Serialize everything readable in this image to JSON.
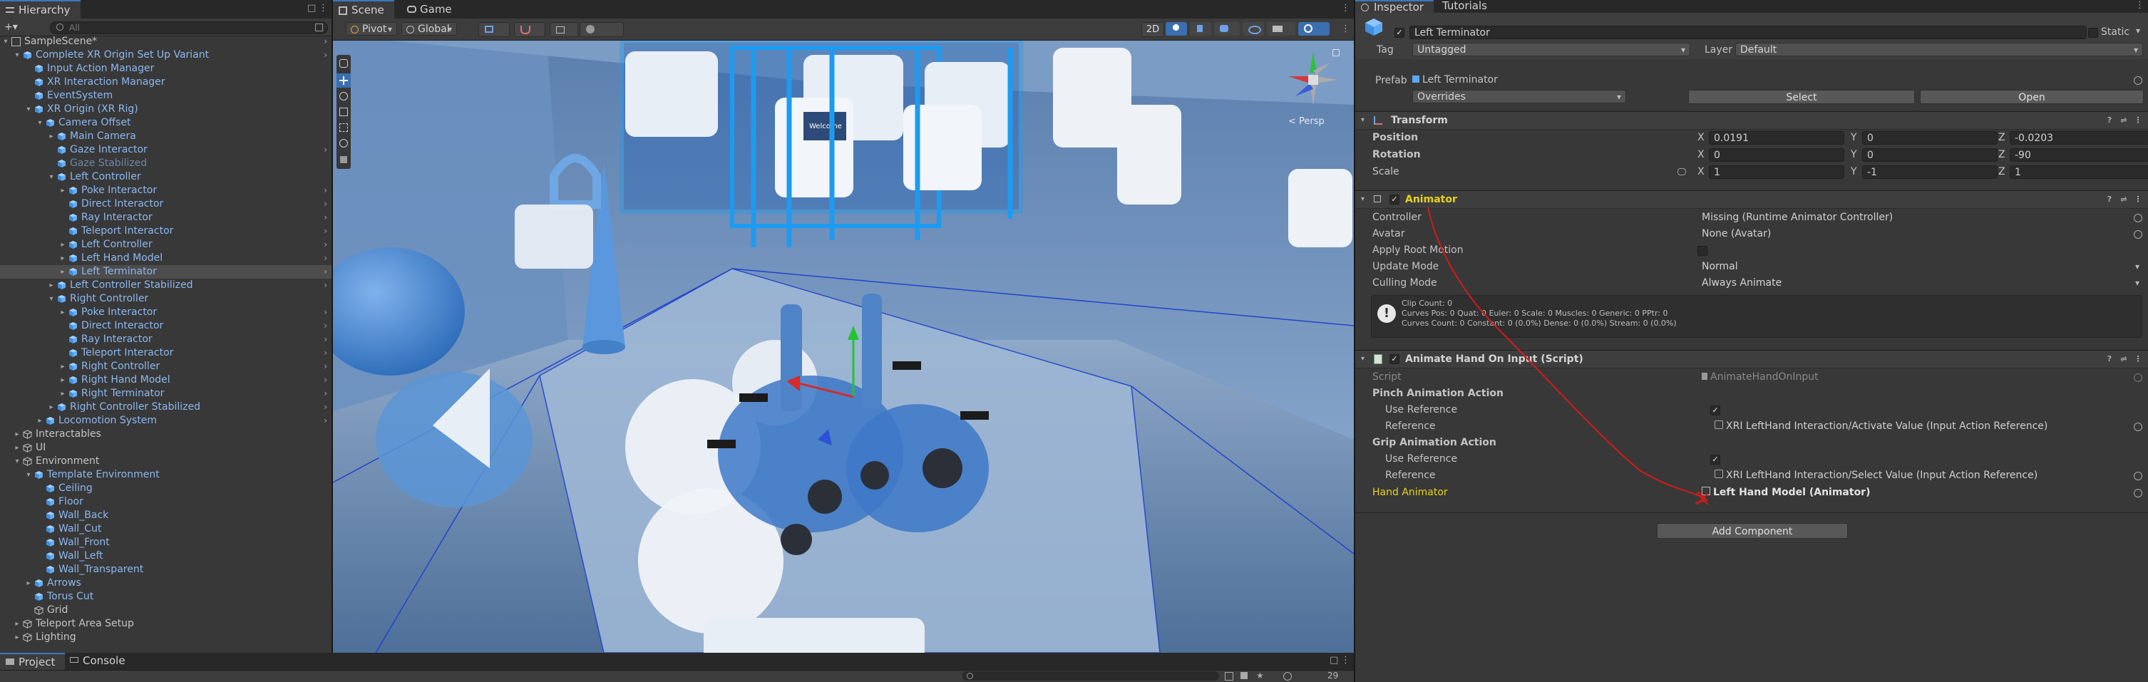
{
  "hierarchy": {
    "tab": "Hierarchy",
    "search_placeholder": "All",
    "rows": [
      {
        "label": "SampleScene*",
        "level": 0,
        "arrow": "▾",
        "kind": "scene",
        "sel": false,
        "more": true
      },
      {
        "label": "Complete XR Origin Set Up Variant",
        "level": 1,
        "arrow": "▾",
        "kind": "prefab",
        "sel": false,
        "more": true
      },
      {
        "label": "Input Action Manager",
        "level": 2,
        "arrow": "",
        "kind": "prefab",
        "sel": false,
        "more": false
      },
      {
        "label": "XR Interaction Manager",
        "level": 2,
        "arrow": "",
        "kind": "prefab",
        "sel": false,
        "more": false
      },
      {
        "label": "EventSystem",
        "level": 2,
        "arrow": "",
        "kind": "prefab",
        "sel": false,
        "more": false
      },
      {
        "label": "XR Origin (XR Rig)",
        "level": 2,
        "arrow": "▾",
        "kind": "prefab",
        "sel": false,
        "more": false
      },
      {
        "label": "Camera Offset",
        "level": 3,
        "arrow": "▾",
        "kind": "prefab",
        "sel": false,
        "more": false
      },
      {
        "label": "Main Camera",
        "level": 4,
        "arrow": "▸",
        "kind": "prefab",
        "sel": false,
        "more": false
      },
      {
        "label": "Gaze Interactor",
        "level": 4,
        "arrow": "",
        "kind": "prefab",
        "sel": false,
        "more": true
      },
      {
        "label": "Gaze Stabilized",
        "level": 4,
        "arrow": "",
        "kind": "dim",
        "sel": false,
        "more": false
      },
      {
        "label": "Left Controller",
        "level": 4,
        "arrow": "▾",
        "kind": "prefab",
        "sel": false,
        "more": false
      },
      {
        "label": "Poke Interactor",
        "level": 5,
        "arrow": "▸",
        "kind": "prefab",
        "sel": false,
        "more": true
      },
      {
        "label": "Direct Interactor",
        "level": 5,
        "arrow": "",
        "kind": "prefab",
        "sel": false,
        "more": true
      },
      {
        "label": "Ray Interactor",
        "level": 5,
        "arrow": "",
        "kind": "prefab",
        "sel": false,
        "more": true
      },
      {
        "label": "Teleport Interactor",
        "level": 5,
        "arrow": "",
        "kind": "prefab",
        "sel": false,
        "more": true
      },
      {
        "label": "Left Controller",
        "level": 5,
        "arrow": "▸",
        "kind": "prefab",
        "sel": false,
        "more": true
      },
      {
        "label": "Left Hand Model",
        "level": 5,
        "arrow": "▸",
        "kind": "prefab",
        "sel": false,
        "more": true
      },
      {
        "label": "Left Terminator",
        "level": 5,
        "arrow": "▸",
        "kind": "prefab",
        "sel": true,
        "more": true
      },
      {
        "label": "Left Controller Stabilized",
        "level": 4,
        "arrow": "▸",
        "kind": "prefab",
        "sel": false,
        "more": true
      },
      {
        "label": "Right Controller",
        "level": 4,
        "arrow": "▾",
        "kind": "prefab",
        "sel": false,
        "more": false
      },
      {
        "label": "Poke Interactor",
        "level": 5,
        "arrow": "▸",
        "kind": "prefab",
        "sel": false,
        "more": true
      },
      {
        "label": "Direct Interactor",
        "level": 5,
        "arrow": "",
        "kind": "prefab",
        "sel": false,
        "more": true
      },
      {
        "label": "Ray Interactor",
        "level": 5,
        "arrow": "",
        "kind": "prefab",
        "sel": false,
        "more": true
      },
      {
        "label": "Teleport Interactor",
        "level": 5,
        "arrow": "",
        "kind": "prefab",
        "sel": false,
        "more": true
      },
      {
        "label": "Right Controller",
        "level": 5,
        "arrow": "▸",
        "kind": "prefab",
        "sel": false,
        "more": true
      },
      {
        "label": "Right Hand Model",
        "level": 5,
        "arrow": "▸",
        "kind": "prefab",
        "sel": false,
        "more": true
      },
      {
        "label": "Right Terminator",
        "level": 5,
        "arrow": "▸",
        "kind": "prefab",
        "sel": false,
        "more": true
      },
      {
        "label": "Right Controller Stabilized",
        "level": 4,
        "arrow": "▸",
        "kind": "prefab",
        "sel": false,
        "more": true
      },
      {
        "label": "Locomotion System",
        "level": 3,
        "arrow": "▸",
        "kind": "prefab",
        "sel": false,
        "more": true
      },
      {
        "label": "Interactables",
        "level": 1,
        "arrow": "▸",
        "kind": "plain",
        "sel": false,
        "more": false
      },
      {
        "label": "UI",
        "level": 1,
        "arrow": "▸",
        "kind": "plain",
        "sel": false,
        "more": false
      },
      {
        "label": "Environment",
        "level": 1,
        "arrow": "▾",
        "kind": "plain",
        "sel": false,
        "more": false
      },
      {
        "label": "Template Environment",
        "level": 2,
        "arrow": "▾",
        "kind": "prefab",
        "sel": false,
        "more": false
      },
      {
        "label": "Ceiling",
        "level": 3,
        "arrow": "",
        "kind": "prefab",
        "sel": false,
        "more": false
      },
      {
        "label": "Floor",
        "level": 3,
        "arrow": "",
        "kind": "prefab",
        "sel": false,
        "more": false
      },
      {
        "label": "Wall_Back",
        "level": 3,
        "arrow": "",
        "kind": "prefab",
        "sel": false,
        "more": false
      },
      {
        "label": "Wall_Cut",
        "level": 3,
        "arrow": "",
        "kind": "prefab",
        "sel": false,
        "more": false
      },
      {
        "label": "Wall_Front",
        "level": 3,
        "arrow": "",
        "kind": "prefab",
        "sel": false,
        "more": false
      },
      {
        "label": "Wall_Left",
        "level": 3,
        "arrow": "",
        "kind": "prefab",
        "sel": false,
        "more": false
      },
      {
        "label": "Wall_Transparent",
        "level": 3,
        "arrow": "",
        "kind": "prefab",
        "sel": false,
        "more": false
      },
      {
        "label": "Arrows",
        "level": 2,
        "arrow": "▸",
        "kind": "prefab",
        "sel": false,
        "more": false
      },
      {
        "label": "Torus Cut",
        "level": 2,
        "arrow": "",
        "kind": "prefab",
        "sel": false,
        "more": false
      },
      {
        "label": "Grid",
        "level": 2,
        "arrow": "",
        "kind": "plain",
        "sel": false,
        "more": false
      },
      {
        "label": "Teleport Area Setup",
        "level": 1,
        "arrow": "▸",
        "kind": "plain",
        "sel": false,
        "more": false
      },
      {
        "label": "Lighting",
        "level": 1,
        "arrow": "▸",
        "kind": "plain",
        "sel": false,
        "more": false
      }
    ]
  },
  "scene": {
    "tabs": [
      "Scene",
      "Game"
    ],
    "pivot": "Pivot",
    "global": "Global",
    "view_2d": "2D",
    "persp": "< Persp",
    "welcome": "Welcome"
  },
  "inspector": {
    "tabs": [
      "Inspector",
      "Tutorials"
    ],
    "object_name": "Left Terminator",
    "static_label": "Static",
    "tag_label": "Tag",
    "tag_value": "Untagged",
    "layer_label": "Layer",
    "layer_value": "Default",
    "prefab_label": "Prefab",
    "prefab_value": "Left Terminator",
    "overrides": "Overrides",
    "select": "Select",
    "open": "Open",
    "transform": {
      "title": "Transform",
      "rows": [
        {
          "label": "Position",
          "x": "0.0191",
          "y": "0",
          "z": "-0.0203"
        },
        {
          "label": "Rotation",
          "x": "0",
          "y": "0",
          "z": "-90"
        },
        {
          "label": "Scale",
          "x": "1",
          "y": "-1",
          "z": "1"
        }
      ]
    },
    "animator": {
      "title": "Animator",
      "controller_label": "Controller",
      "controller_value": "Missing (Runtime Animator Controller)",
      "avatar_label": "Avatar",
      "avatar_value": "None (Avatar)",
      "root_motion_label": "Apply Root Motion",
      "update_label": "Update Mode",
      "update_value": "Normal",
      "culling_label": "Culling Mode",
      "culling_value": "Always Animate",
      "info_lines": [
        "Clip Count: 0",
        "Curves Pos: 0 Quat: 0 Euler: 0 Scale: 0 Muscles: 0 Generic: 0 PPtr: 0",
        "Curves Count: 0 Constant: 0 (0.0%) Dense: 0 (0.0%) Stream: 0 (0.0%)"
      ]
    },
    "animate_hand": {
      "title": "Animate Hand On Input (Script)",
      "script_label": "Script",
      "script_value": "AnimateHandOnInput",
      "pinch_label": "Pinch Animation Action",
      "use_ref_label": "Use Reference",
      "reference_label": "Reference",
      "pinch_ref": "XRI LeftHand Interaction/Activate Value (Input Action Reference)",
      "grip_label": "Grip Animation Action",
      "grip_ref": "XRI LeftHand Interaction/Select Value (Input Action Reference)",
      "hand_animator_label": "Hand Animator",
      "hand_animator_value": "Left Hand Model (Animator)"
    },
    "add_component": "Add Component"
  },
  "bottom": {
    "tabs": [
      "Project",
      "Console"
    ],
    "count": "29"
  },
  "colors": {
    "accent_yellow": "#e8d21c",
    "prefab_blue": "#8cb8f0",
    "annotation_red": "#d21a1a"
  }
}
